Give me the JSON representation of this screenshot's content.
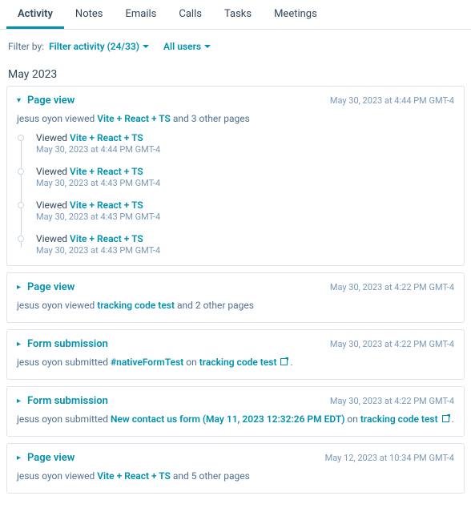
{
  "tabs": [
    "Activity",
    "Notes",
    "Emails",
    "Calls",
    "Tasks",
    "Meetings"
  ],
  "activeTab": 0,
  "filter": {
    "label": "Filter by:",
    "activity": "Filter activity (24/33)",
    "users": "All users"
  },
  "month": "May 2023",
  "events": [
    {
      "expanded": true,
      "title": "Page view",
      "timestamp": "May 30, 2023 at 4:44 PM GMT-4",
      "body_pre": "jesus oyon viewed ",
      "body_link": "Vite + React + TS",
      "body_post": " and 3 other pages",
      "details": [
        {
          "pre": "Viewed ",
          "link": "Vite + React + TS",
          "time": "May 30, 2023 at 4:44 PM GMT-4"
        },
        {
          "pre": "Viewed ",
          "link": "Vite + React + TS",
          "time": "May 30, 2023 at 4:43 PM GMT-4"
        },
        {
          "pre": "Viewed ",
          "link": "Vite + React + TS",
          "time": "May 30, 2023 at 4:43 PM GMT-4"
        },
        {
          "pre": "Viewed ",
          "link": "Vite + React + TS",
          "time": "May 30, 2023 at 4:43 PM GMT-4"
        }
      ]
    },
    {
      "expanded": false,
      "title": "Page view",
      "timestamp": "May 30, 2023 at 4:22 PM GMT-4",
      "body_pre": "jesus oyon viewed ",
      "body_link": "tracking code test",
      "body_post": " and 2 other pages"
    },
    {
      "expanded": false,
      "title": "Form submission",
      "timestamp": "May 30, 2023 at 4:22 PM GMT-4",
      "body_pre": "jesus oyon submitted ",
      "body_link": "#nativeFormTest",
      "body_mid": " on ",
      "body_link2": "tracking code test",
      "body_ext": true,
      "body_post": " ."
    },
    {
      "expanded": false,
      "title": "Form submission",
      "timestamp": "May 30, 2023 at 4:22 PM GMT-4",
      "body_pre": "jesus oyon submitted ",
      "body_link": "New contact us form (May 11, 2023 12:32:26 PM EDT)",
      "body_mid": " on ",
      "body_link2": "tracking code test",
      "body_ext": true,
      "body_post": " ."
    },
    {
      "expanded": false,
      "title": "Page view",
      "timestamp": "May 12, 2023 at 10:34 PM GMT-4",
      "body_pre": "jesus oyon viewed ",
      "body_link": "Vite + React + TS",
      "body_post": " and 5 other pages"
    }
  ]
}
